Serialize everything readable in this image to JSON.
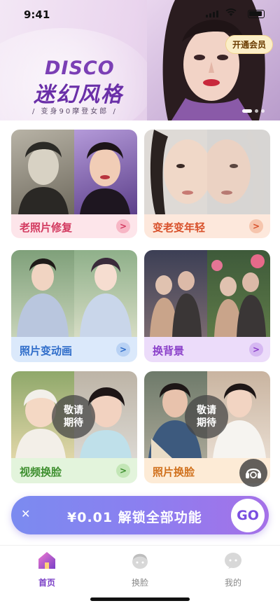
{
  "status": {
    "time": "9:41"
  },
  "banner": {
    "title_en": "DISCO",
    "title_cn": "迷幻风格",
    "tagline": "/ 变身90摩登女郎 /",
    "member_button": "开通会员"
  },
  "cards": [
    {
      "label": "老照片修复",
      "arrow": ">"
    },
    {
      "label": "变老变年轻",
      "arrow": ">"
    },
    {
      "label": "照片变动画",
      "arrow": ">"
    },
    {
      "label": "换背景",
      "arrow": ">"
    },
    {
      "label": "视频换脸",
      "arrow": ">",
      "badge": "敬请期待"
    },
    {
      "label": "照片换脸",
      "badge": "敬请期待"
    }
  ],
  "unlock": {
    "close": "✕",
    "text": "¥0.01 解锁全部功能",
    "go": "GO"
  },
  "tabs": [
    {
      "label": "首页",
      "icon": "home-icon",
      "active": true
    },
    {
      "label": "换脸",
      "icon": "face-swap-icon"
    },
    {
      "label": "我的",
      "icon": "profile-icon"
    }
  ],
  "colors": {
    "accent": "#7a3fc6",
    "card1_footer": "#fde5ea",
    "card1_text": "#d33a60",
    "card2_footer": "#fde8dc",
    "card2_text": "#d8502a",
    "card3_footer": "#dbe9fb",
    "card3_text": "#2e6cc9",
    "card4_footer": "#ecdcfa",
    "card4_text": "#8a3fc9",
    "card5_footer": "#e3f4dc",
    "card5_text": "#3e8f2f",
    "card6_footer": "#fdebd6",
    "card6_text": "#d0701c"
  }
}
